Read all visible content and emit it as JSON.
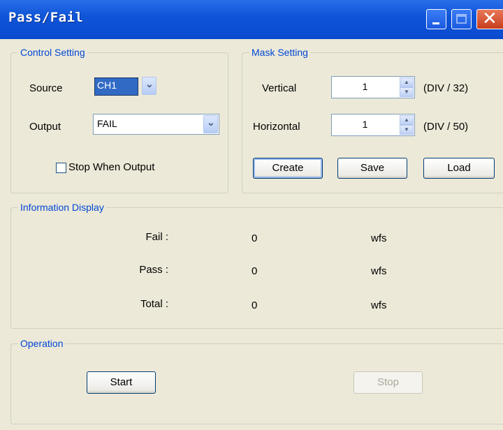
{
  "window": {
    "title": "Pass/Fail"
  },
  "control_setting": {
    "legend": "Control Setting",
    "source_label": "Source",
    "source_value": "CH1",
    "output_label": "Output",
    "output_value": "FAIL",
    "stop_when_output_label": "Stop When Output",
    "stop_when_output_checked": false
  },
  "mask_setting": {
    "legend": "Mask Setting",
    "vertical_label": "Vertical",
    "vertical_value": "1",
    "vertical_unit": "(DIV / 32)",
    "horizontal_label": "Horizontal",
    "horizontal_value": "1",
    "horizontal_unit": "(DIV / 50)",
    "create_label": "Create",
    "save_label": "Save",
    "load_label": "Load"
  },
  "information_display": {
    "legend": "Information Display",
    "rows": [
      {
        "label": "Fail :",
        "value": "0",
        "unit": "wfs"
      },
      {
        "label": "Pass :",
        "value": "0",
        "unit": "wfs"
      },
      {
        "label": "Total :",
        "value": "0",
        "unit": "wfs"
      }
    ]
  },
  "operation": {
    "legend": "Operation",
    "start_label": "Start",
    "stop_label": "Stop",
    "stop_enabled": false
  },
  "icons": [
    "minimize-icon",
    "maximize-icon",
    "close-icon",
    "chevron-down-icon",
    "spin-up-icon",
    "spin-down-icon"
  ]
}
